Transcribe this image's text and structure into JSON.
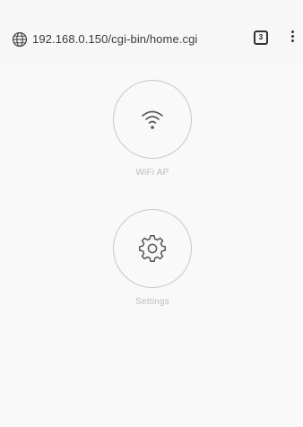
{
  "browser": {
    "url": "192.168.0.150/cgi-bin/home.cgi",
    "tab_count": "3",
    "icons": {
      "site": "globe-icon",
      "menu": "more-vertical-icon"
    }
  },
  "tiles": [
    {
      "label": "WiFi AP",
      "icon": "wifi-icon"
    },
    {
      "label": "Settings",
      "icon": "gear-icon"
    }
  ],
  "colors": {
    "background": "#f7f7f7",
    "icon_stroke": "#555555",
    "label": "#bdbdbd",
    "circle_border": "#c8c8c8"
  }
}
